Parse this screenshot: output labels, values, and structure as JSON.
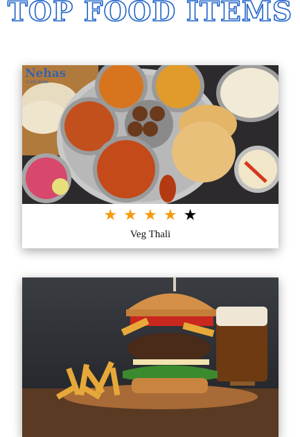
{
  "page": {
    "title": "TOP FOOD ITEMS"
  },
  "cards": [
    {
      "name": "Veg Thali",
      "rating": 4,
      "max_rating": 5,
      "image_watermark": "Nehas",
      "image_watermark_sub": "Cook Book",
      "image_description_icon": "veg-thali-photo"
    },
    {
      "name": "",
      "image_description_icon": "burger-fries-photo"
    }
  ],
  "colors": {
    "title_outline": "#1e62c8",
    "star_filled": "#f59a0c",
    "star_empty": "#000000"
  }
}
